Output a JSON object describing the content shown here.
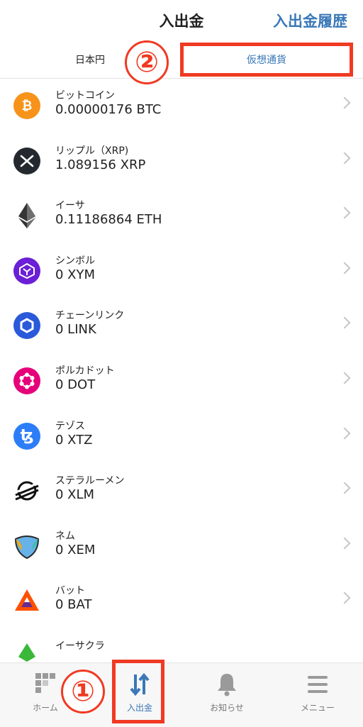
{
  "header": {
    "title": "入出金",
    "history_link": "入出金履歴"
  },
  "tabs": {
    "jpy": "日本円",
    "crypto": "仮想通貨"
  },
  "annotations": {
    "step1": "①",
    "step2": "②"
  },
  "coins": [
    {
      "name": "ビットコイン",
      "amount": "0.00000176 BTC",
      "icon": "bitcoin-icon",
      "color": "#F7931A",
      "glyph": "₿"
    },
    {
      "name": "リップル（XRP)",
      "amount": "1.089156 XRP",
      "icon": "xrp-icon",
      "color": "#23292F",
      "glyph": "✕"
    },
    {
      "name": "イーサ",
      "amount": "0.11186864 ETH",
      "icon": "ethereum-icon",
      "color": "#ffffff",
      "glyph": ""
    },
    {
      "name": "シンボル",
      "amount": "0 XYM",
      "icon": "symbol-icon",
      "color": "#6B1FD6",
      "glyph": "Y"
    },
    {
      "name": "チェーンリンク",
      "amount": "0 LINK",
      "icon": "chainlink-icon",
      "color": "#2A5ADA",
      "glyph": "⬡"
    },
    {
      "name": "ポルカドット",
      "amount": "0 DOT",
      "icon": "polkadot-icon",
      "color": "#E6007A",
      "glyph": "●"
    },
    {
      "name": "テゾス",
      "amount": "0 XTZ",
      "icon": "tezos-icon",
      "color": "#2C7DF7",
      "glyph": "ꜩ"
    },
    {
      "name": "ステラルーメン",
      "amount": "0 XLM",
      "icon": "stellar-icon",
      "color": "#ffffff",
      "glyph": ""
    },
    {
      "name": "ネム",
      "amount": "0 XEM",
      "icon": "nem-icon",
      "color": "#ffffff",
      "glyph": ""
    },
    {
      "name": "バット",
      "amount": "0 BAT",
      "icon": "bat-icon",
      "color": "#ffffff",
      "glyph": ""
    },
    {
      "name": "イーサクラ",
      "amount": "",
      "icon": "ethereum-classic-icon",
      "color": "#ffffff",
      "glyph": ""
    }
  ],
  "tabbar": {
    "home": "ホーム",
    "deposit": "入出金",
    "notifications": "お知らせ",
    "menu": "メニュー",
    "active_color": "#3a78b8"
  }
}
